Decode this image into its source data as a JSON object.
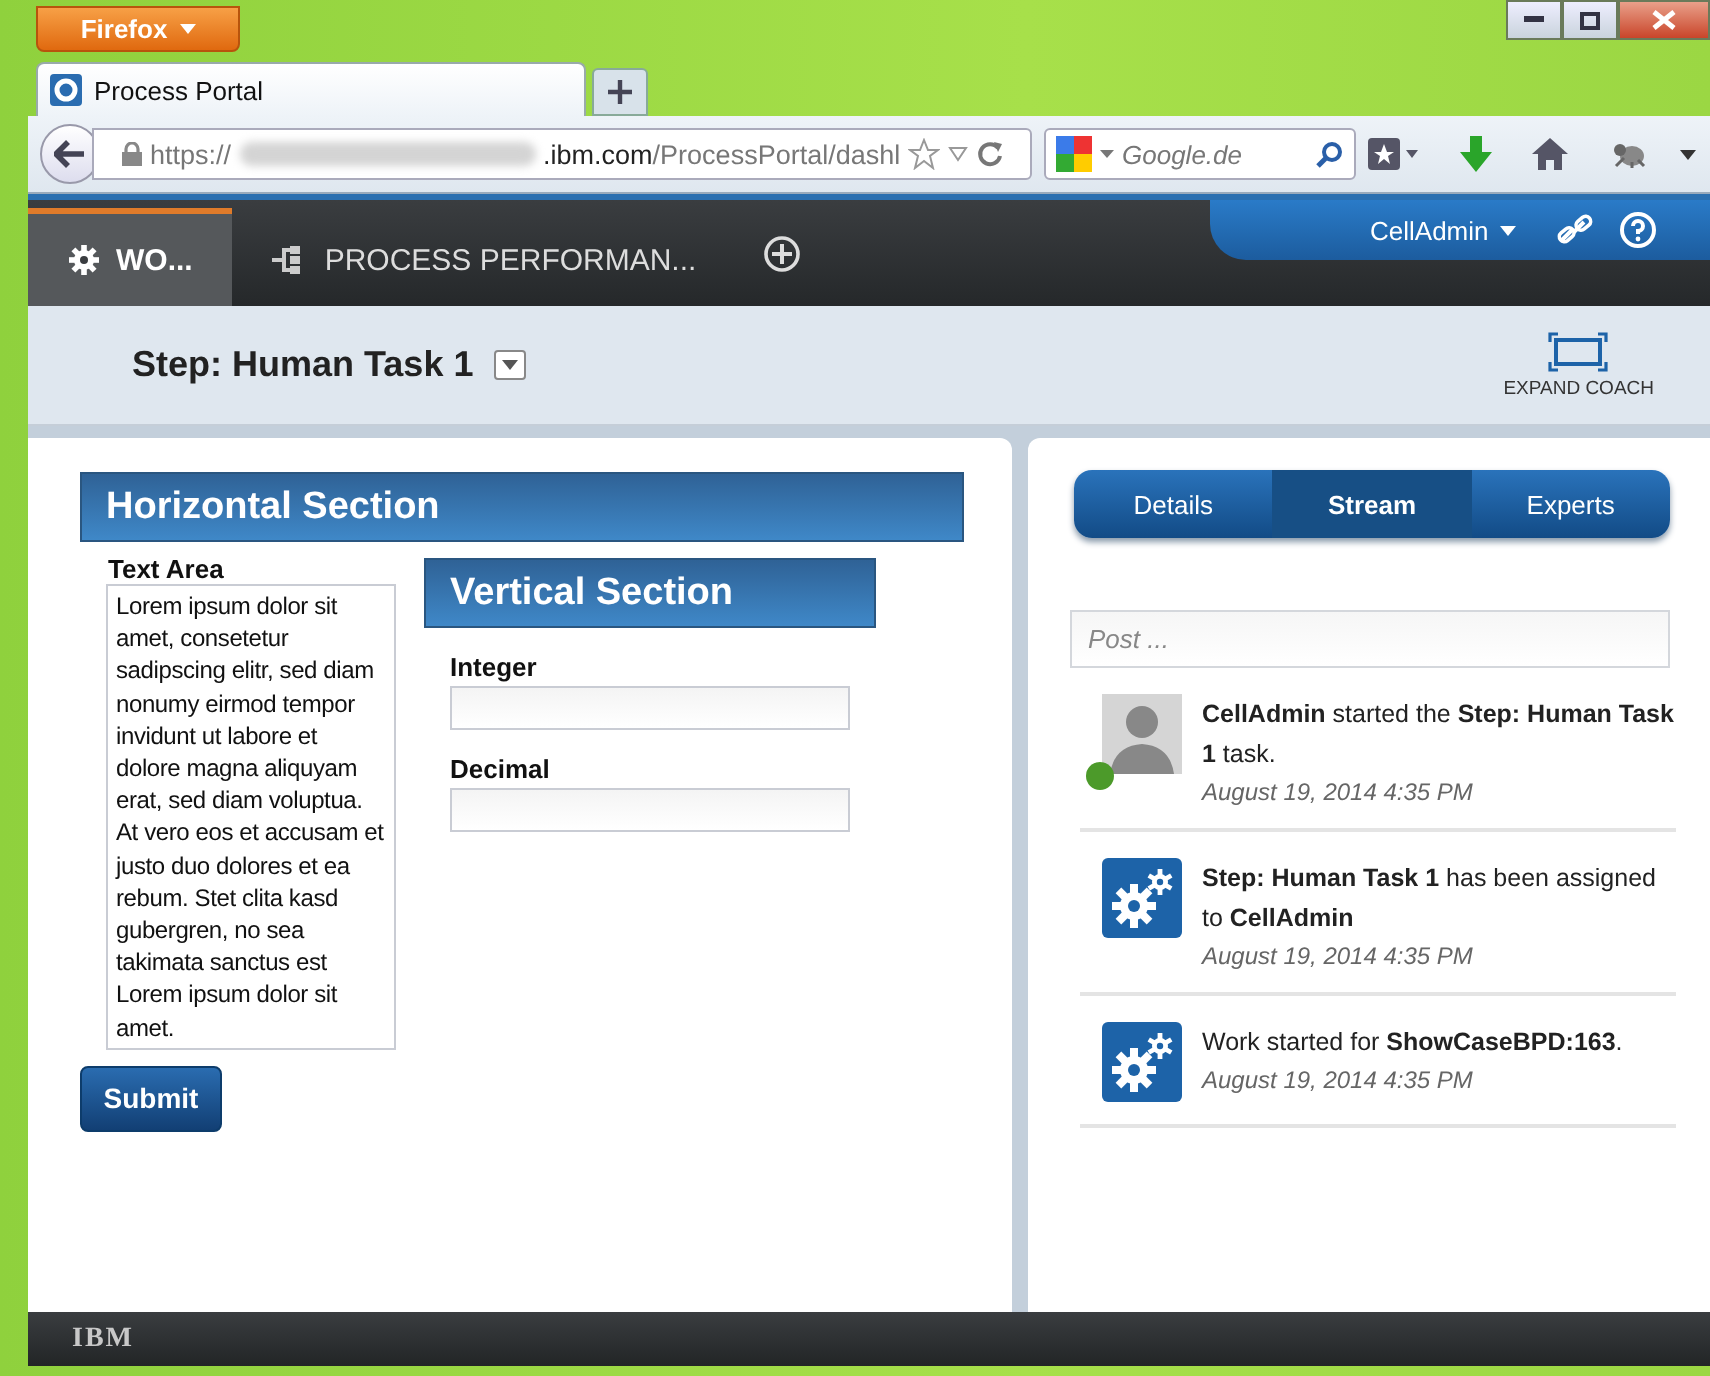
{
  "browser": {
    "menu_button": "Firefox",
    "tab": {
      "title": "Process Portal"
    },
    "address": {
      "scheme": "https://",
      "host": ".ibm.com",
      "path": "/ProcessPortal/dashl"
    },
    "search": {
      "placeholder": "Google.de"
    }
  },
  "portal": {
    "tabs": [
      {
        "label": "WO...",
        "selected": true,
        "kind": "gear"
      },
      {
        "label": "PROCESS PERFORMAN...",
        "selected": false,
        "kind": "hierarchy"
      }
    ],
    "user": "CellAdmin"
  },
  "task": {
    "title": "Step: Human Task 1",
    "expand_label": "EXPAND COACH"
  },
  "form": {
    "horizontal_title": "Horizontal Section",
    "text_area": {
      "label": "Text Area",
      "value": "Lorem ipsum dolor sit amet, consetetur sadipscing elitr, sed diam nonumy eirmod tempor invidunt ut labore et dolore magna aliquyam erat, sed diam voluptua. At vero eos et accusam et justo duo dolores et ea rebum. Stet clita kasd gubergren, no sea takimata sanctus est Lorem ipsum dolor sit amet."
    },
    "vertical_title": "Vertical Section",
    "fields": [
      {
        "label": "Integer"
      },
      {
        "label": "Decimal"
      }
    ],
    "submit": "Submit"
  },
  "stream": {
    "tabs": [
      {
        "label": "Details",
        "selected": false
      },
      {
        "label": "Stream",
        "selected": true
      },
      {
        "label": "Experts",
        "selected": false
      }
    ],
    "post_placeholder": "Post ...",
    "items": [
      {
        "kind": "user",
        "online": true,
        "text": "**CellAdmin** started the **Step: Human Task 1** task.",
        "time": "August 19, 2014 4:35 PM"
      },
      {
        "kind": "system",
        "online": false,
        "text": "**Step: Human Task 1** has been assigned to **CellAdmin**",
        "time": "August 19, 2014 4:35 PM"
      },
      {
        "kind": "system",
        "online": false,
        "text": "Work started for **ShowCaseBPD:163**.",
        "time": "August 19, 2014 4:35 PM"
      }
    ]
  },
  "footer": {
    "logo": "IBM"
  }
}
